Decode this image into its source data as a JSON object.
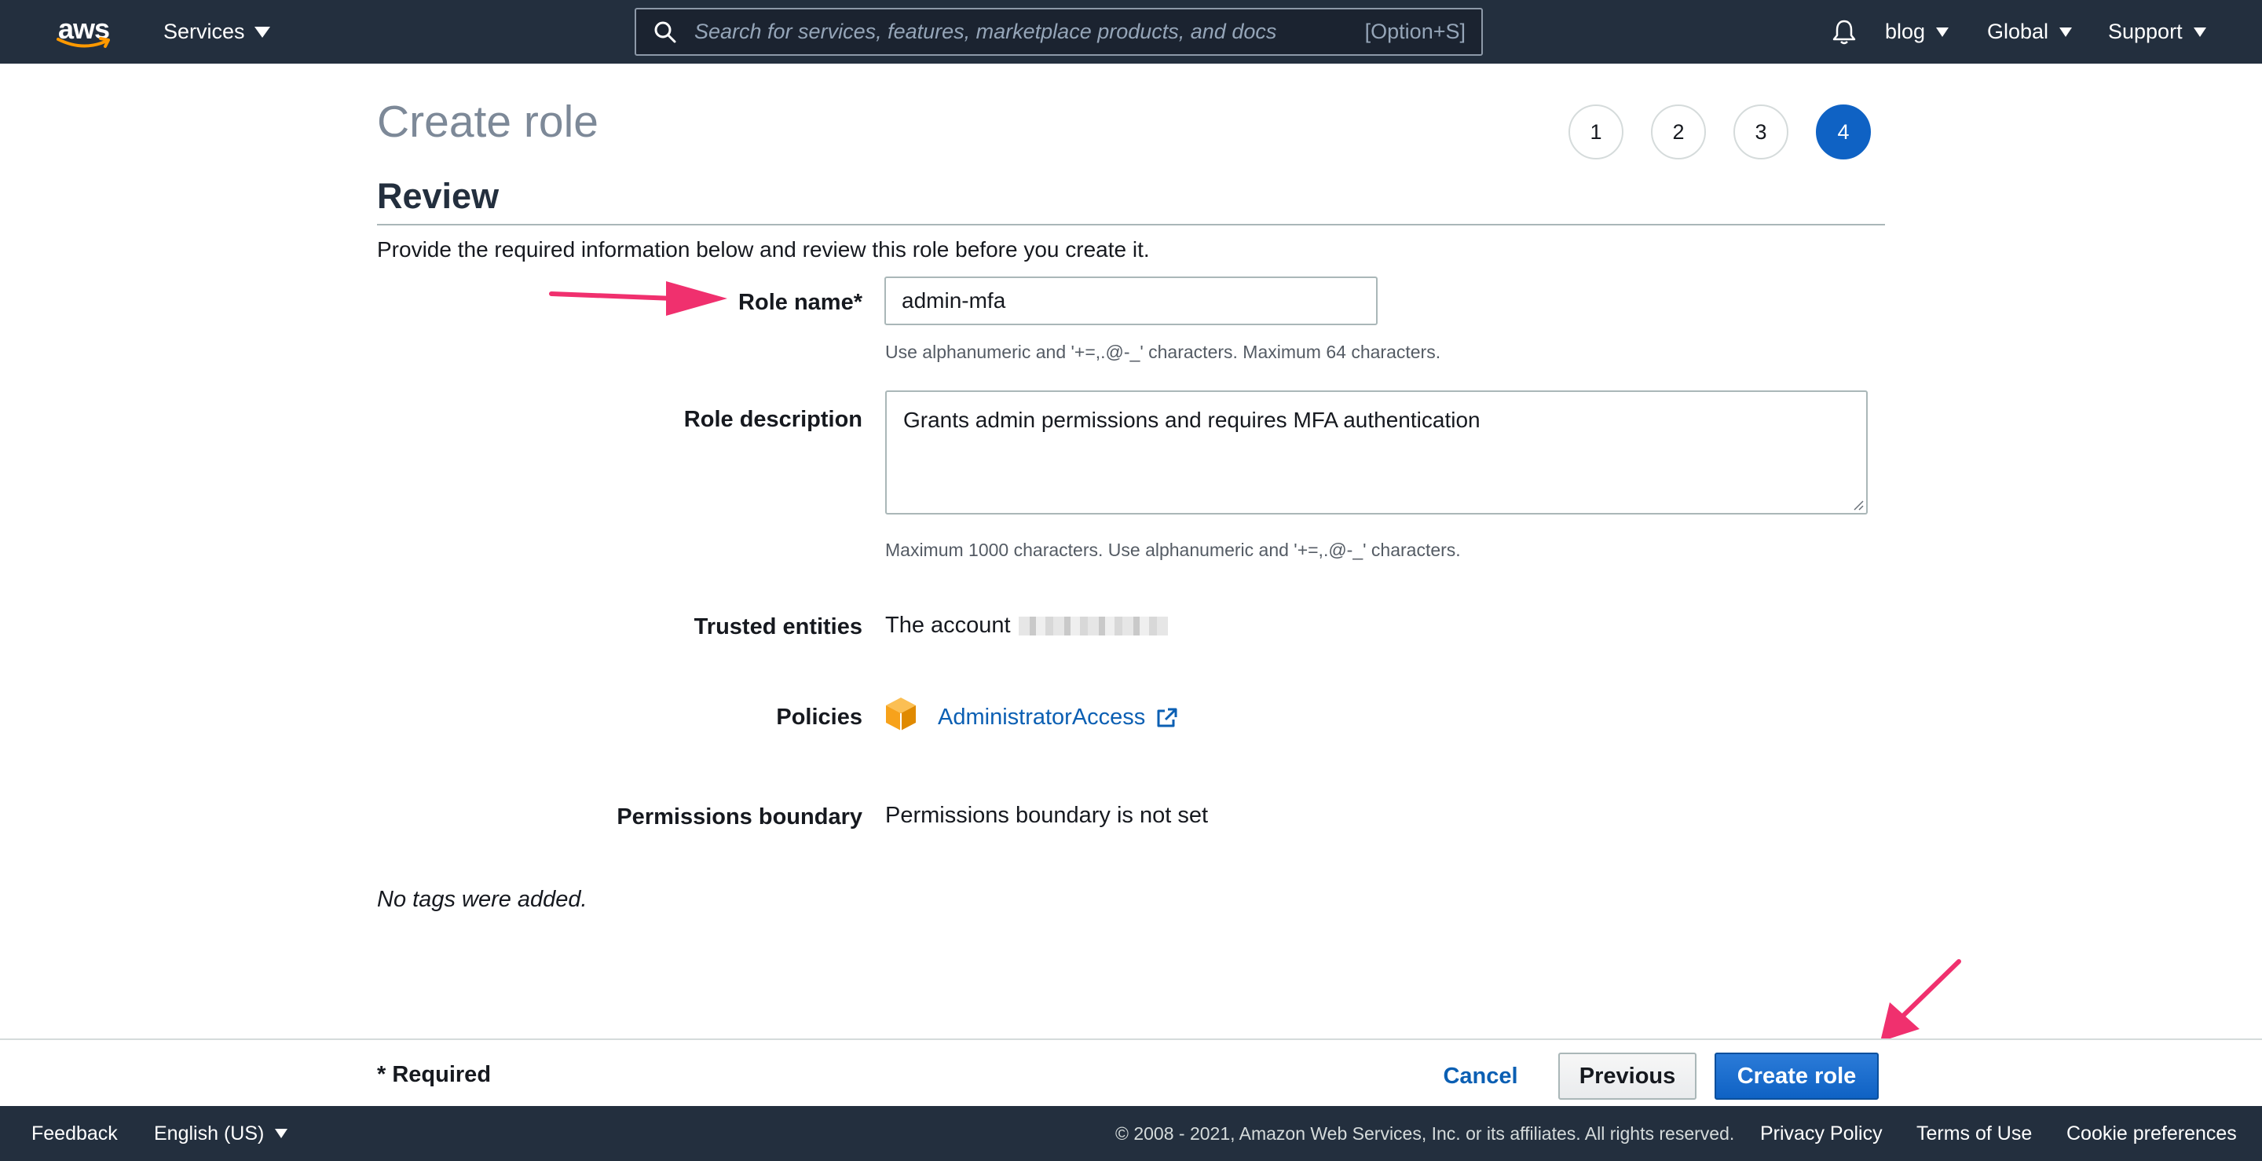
{
  "topnav": {
    "logo_text": "aws",
    "services_label": "Services",
    "search_placeholder": "Search for services, features, marketplace products, and docs",
    "search_shortcut": "[Option+S]",
    "account_label": "blog",
    "region_label": "Global",
    "support_label": "Support"
  },
  "page": {
    "title": "Create role",
    "steps": [
      "1",
      "2",
      "3",
      "4"
    ],
    "active_step": 4,
    "section_title": "Review",
    "intro": "Provide the required information below and review this role before you create it."
  },
  "form": {
    "role_name_label": "Role name*",
    "role_name_value": "admin-mfa",
    "role_name_hint": "Use alphanumeric and '+=,.@-_' characters. Maximum 64 characters.",
    "role_description_label": "Role description",
    "role_description_value": "Grants admin permissions and requires MFA authentication",
    "role_description_hint": "Maximum 1000 characters. Use alphanumeric and '+=,.@-_' characters.",
    "trusted_entities_label": "Trusted entities",
    "trusted_entities_value": "The account",
    "policies_label": "Policies",
    "policy_name": "AdministratorAccess",
    "permissions_boundary_label": "Permissions boundary",
    "permissions_boundary_value": "Permissions boundary is not set",
    "no_tags": "No tags were added."
  },
  "actions": {
    "required_note": "* Required",
    "cancel_label": "Cancel",
    "previous_label": "Previous",
    "create_label": "Create role"
  },
  "footer": {
    "feedback": "Feedback",
    "language": "English (US)",
    "copyright": "© 2008 - 2021, Amazon Web Services, Inc. or its affiliates. All rights reserved.",
    "privacy": "Privacy Policy",
    "terms": "Terms of Use",
    "cookies": "Cookie preferences"
  },
  "colors": {
    "nav_bg": "#232f3e",
    "primary": "#0f62c4",
    "link": "#0b5fb3",
    "annotation": "#f0306e",
    "policy_icon": "#f7a21b"
  },
  "icons": [
    "search-icon",
    "bell-icon",
    "policy-cube-icon",
    "external-link-icon",
    "annotation-arrow"
  ]
}
